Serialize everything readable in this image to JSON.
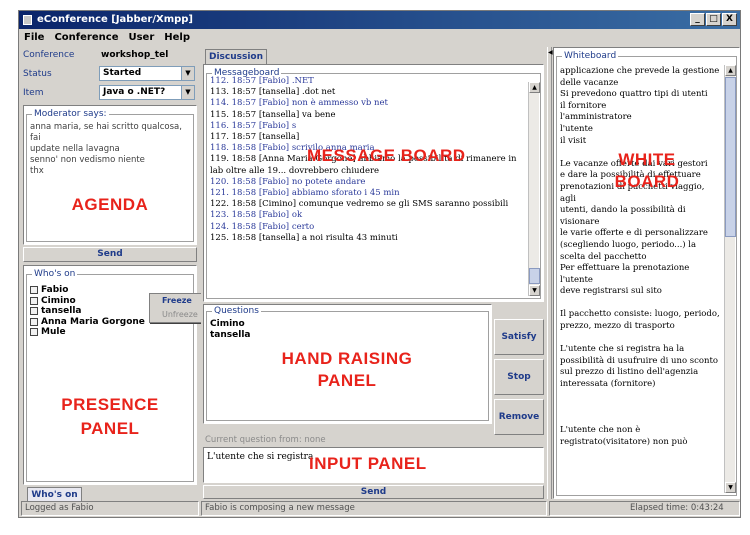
{
  "window": {
    "title": "eConference [Jabber/Xmpp]",
    "buttons": [
      "_",
      "□",
      "X"
    ]
  },
  "menu": [
    "File",
    "Conference",
    "User",
    "Help"
  ],
  "conference": {
    "label": "Conference",
    "value": "workshop_tel",
    "status_label": "Status",
    "status_value": "Started",
    "item_label": "Item",
    "item_value": "Java o .NET?"
  },
  "moderator": {
    "title": "Moderator says:",
    "text_lines": [
      "anna maria, se hai scritto qualcosa, fai",
      "update nella lavagna",
      "senno' non vedismo niente",
      "thx"
    ],
    "overlay": "AGENDA",
    "send_label": "Send"
  },
  "presence": {
    "title": "Who's on",
    "users": [
      "Fabio",
      "Cimino",
      "tansella",
      "Anna Maria Gorgone",
      "Mule"
    ],
    "overlay": [
      "PRESENCE",
      "PANEL"
    ],
    "tab_label": "Who's on",
    "context_menu": [
      "Freeze",
      "Unfreeze"
    ]
  },
  "discussion": {
    "tab_label": "Discussion",
    "messageboard_title": "Messageboard",
    "overlay": "MESSAGE BOARD",
    "messages": [
      {
        "text": "112. 18:57 [Fabio] .NET",
        "color": "#2b3a9a"
      },
      {
        "text": "113. 18:57 [tansella] .dot net",
        "color": "#000000"
      },
      {
        "text": "114. 18:57 [Fabio] non è ammesso vb net",
        "color": "#2b3a9a"
      },
      {
        "text": "115. 18:57 [tansella] va bene",
        "color": "#000000"
      },
      {
        "text": "116. 18:57 [Fabio] s",
        "color": "#2b3a9a"
      },
      {
        "text": "117. 18:57 [tansella]",
        "color": "#000000"
      },
      {
        "text": "118. 18:58 [Fabio] scrivilo anna maria",
        "color": "#2b3a9a"
      },
      {
        "text": "119. 18:58 [Anna Maria Gorgone] abbiamo la possibilità di rimanere in",
        "color": "#000000"
      },
      {
        "text": "lab oltre alle 19... dovrebbero chiudere",
        "color": "#000000"
      },
      {
        "text": "120. 18:58 [Fabio] no potete andare",
        "color": "#2b3a9a"
      },
      {
        "text": "121. 18:58 [Fabio] abbiamo sforato i 45 min",
        "color": "#2b3a9a"
      },
      {
        "text": "122. 18:58 [Cimino] comunque vedremo se gli SMS saranno possibili",
        "color": "#000000"
      },
      {
        "text": "123. 18:58 [Fabio] ok",
        "color": "#2b3a9a"
      },
      {
        "text": "124. 18:58 [Fabio] certo",
        "color": "#2b3a9a"
      },
      {
        "text": "125. 18:58 [tansella] a noi risulta 43 minuti",
        "color": "#000000"
      }
    ]
  },
  "questions": {
    "title": "Questions",
    "queue": [
      "Cimino",
      "tansella"
    ],
    "overlay": [
      "HAND RAISING",
      "PANEL"
    ],
    "satisfy_label": "Satisfy",
    "stop_label": "Stop",
    "remove_label": "Remove"
  },
  "input": {
    "current_label": "Current question from: none",
    "text": "L'utente che si registra",
    "overlay": "INPUT PANEL",
    "send_label": "Send"
  },
  "whiteboard": {
    "title": "Whiteboard",
    "overlay": [
      "WHITE",
      "BOARD"
    ],
    "lines": [
      "applicazione che prevede la gestione",
      "delle vacanze",
      "Si prevedono quattro tipi di utenti",
      "il fornitore",
      "l'amministratore",
      "l'utente",
      "il visit",
      "",
      "Le vacanze offerte dai vari gestori",
      "e dare la possibilità di effettuare",
      "prenotazioni di pacchetti viaggio, agli",
      "utenti, dando la possibilità di visionare",
      "le varie offerte e di personalizzare",
      "(scegliendo luogo, periodo...) la",
      "scelta del pacchetto",
      "Per effettuare la prenotazione l'utente",
      "deve registrarsi sul sito",
      "",
      "Il pacchetto consiste: luogo, periodo,",
      "prezzo, mezzo di trasporto",
      "",
      "L'utente che si registra ha la",
      "possibilità di usufruire di uno sconto",
      "sul prezzo di listino dell'agenzia",
      "interessata (fornitore)",
      "",
      "",
      "",
      "L'utente che non è",
      "registrato(visitatore) non può"
    ]
  },
  "status": {
    "left": "Logged as Fabio",
    "middle": "Fabio is composing a new message",
    "right": "Elapsed time: 0:43:24"
  }
}
